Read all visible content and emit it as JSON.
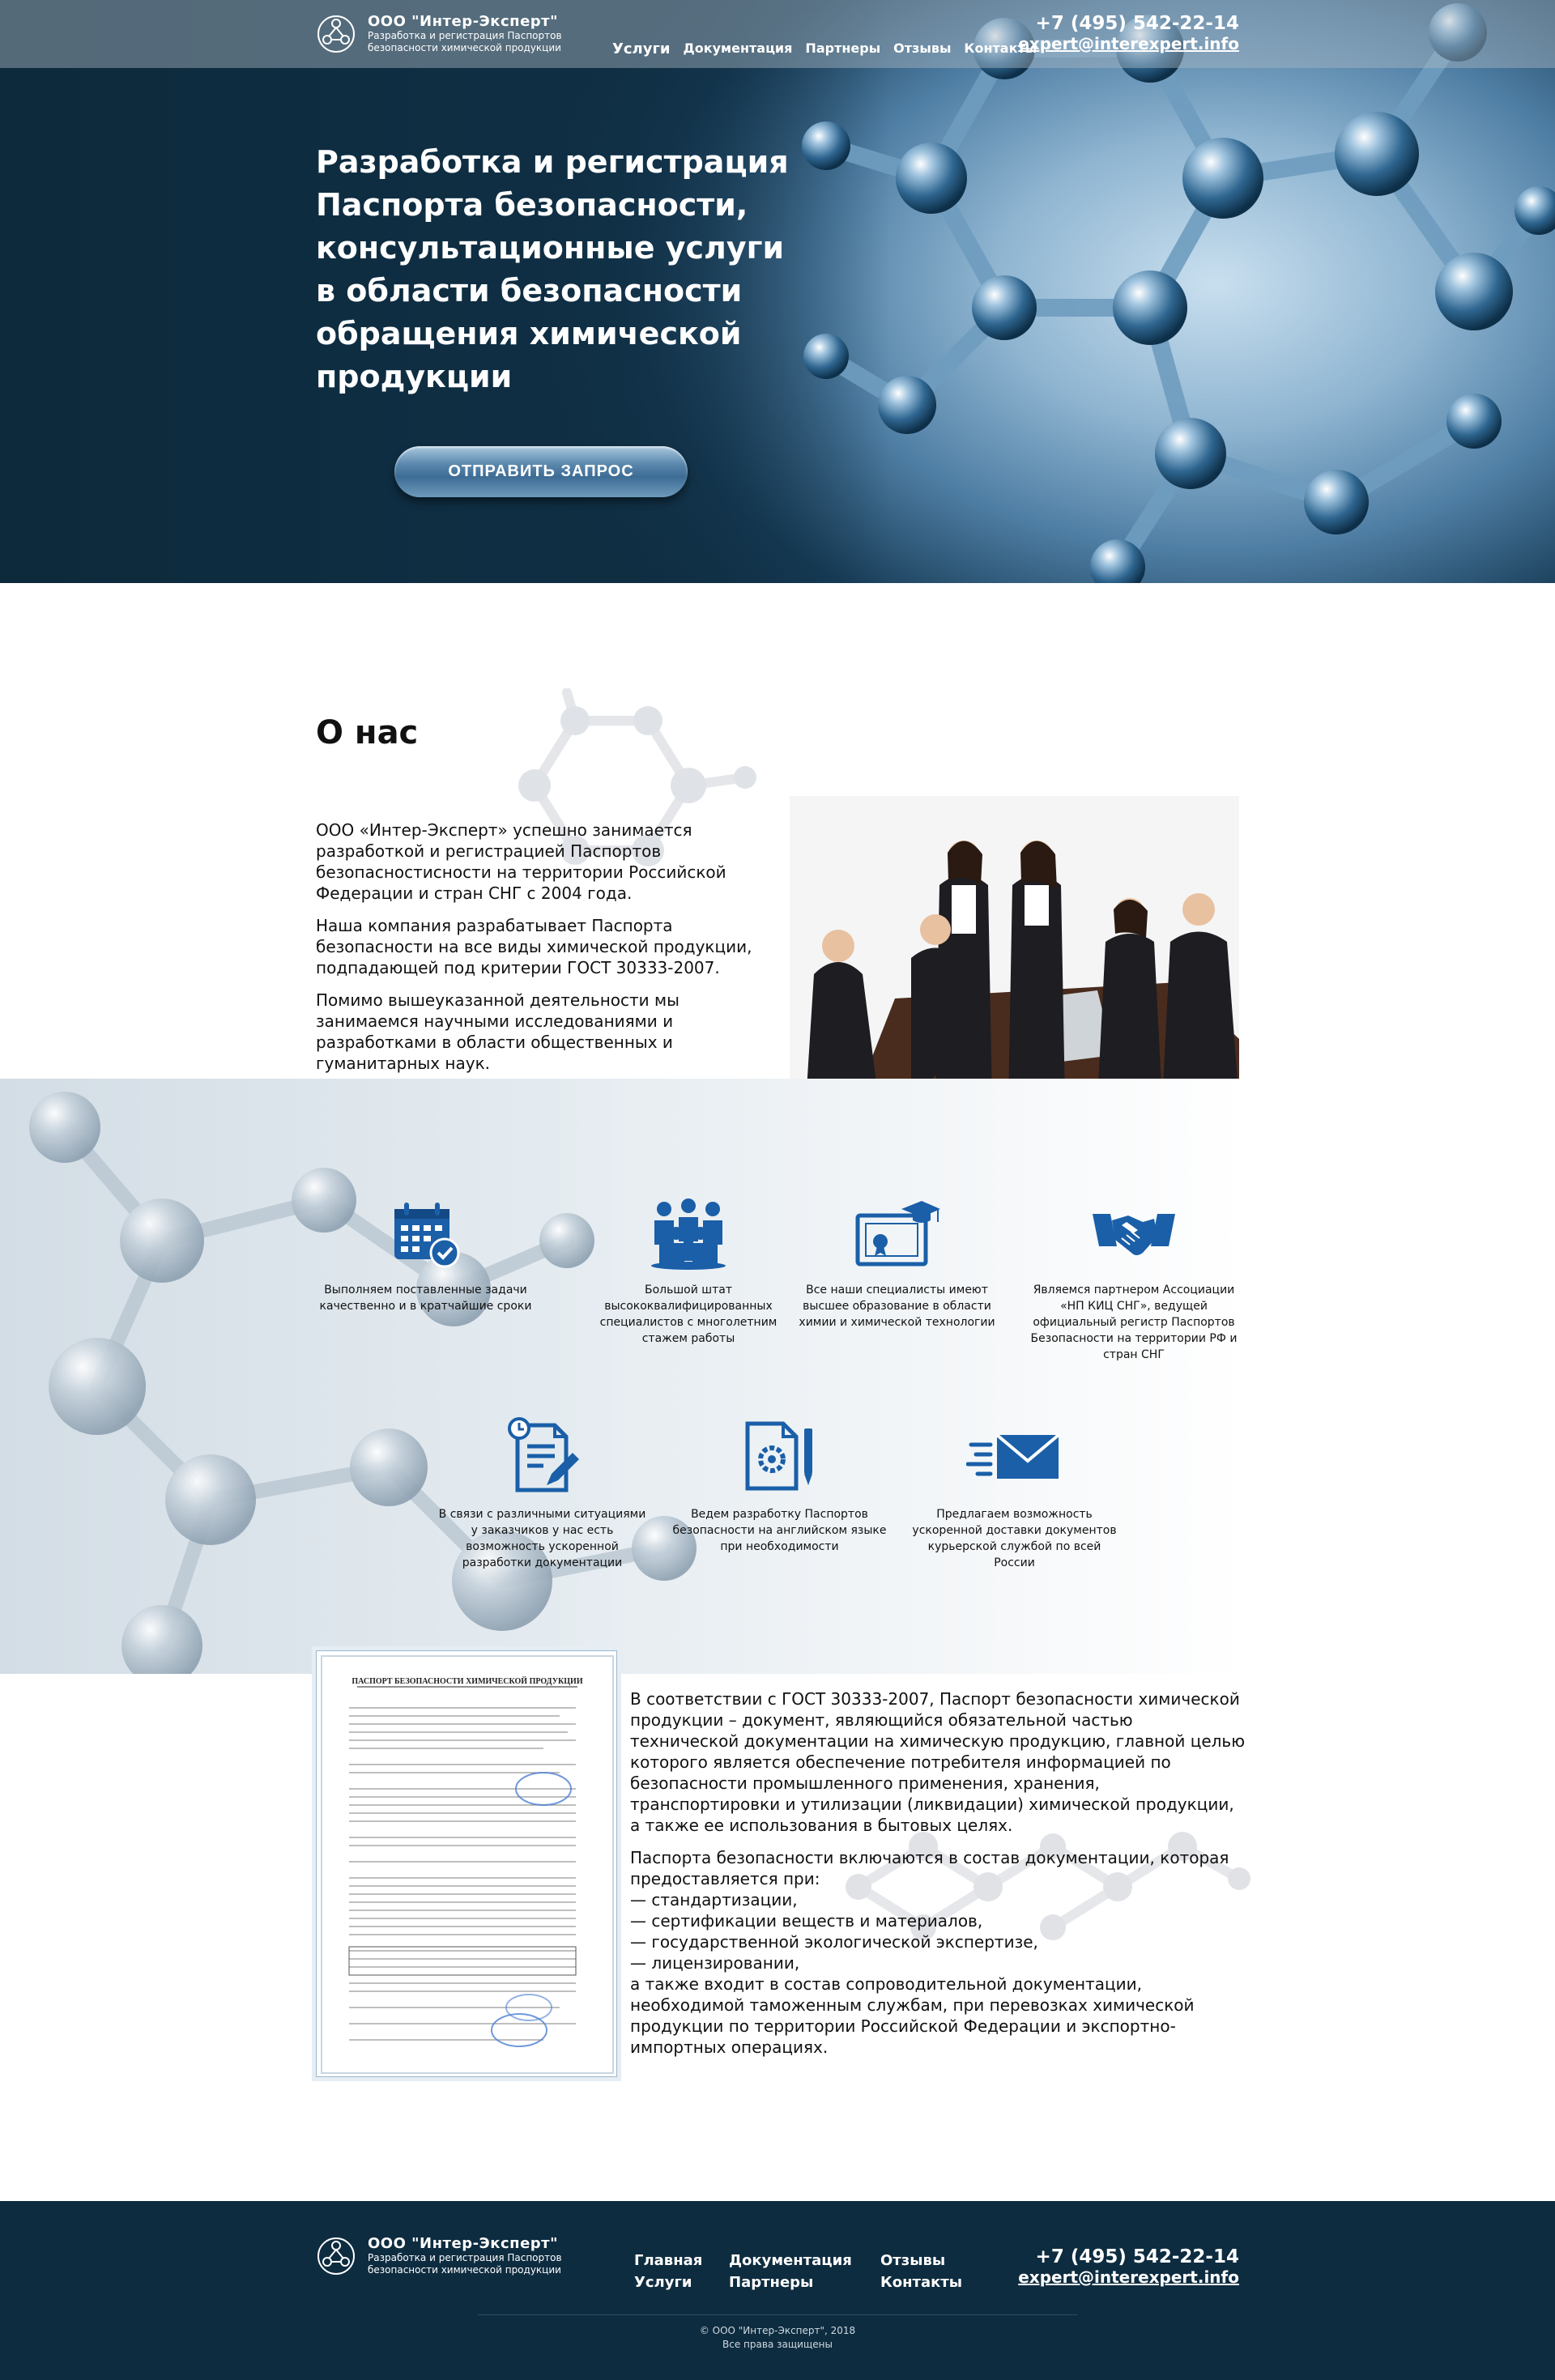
{
  "header": {
    "company_name": "ООО \"Интер-Эксперт\"",
    "tagline_line1": "Разработка и регистрация Паспортов",
    "tagline_line2": "безопасности химической продукции",
    "nav": [
      "Услуги",
      "Документация",
      "Партнеры",
      "Отзывы",
      "Контакты"
    ],
    "phone": "+7 (495) 542-22-14",
    "email": "expert@interexpert.info"
  },
  "hero": {
    "title_lines": [
      "Разработка и регистрация",
      "Паспорта безопасности,",
      "консультационные услуги",
      "в области безопасности",
      "обращения химической",
      "продукции"
    ],
    "cta_label": "ОТПРАВИТЬ ЗАПРОС"
  },
  "about": {
    "title": "О нас",
    "paragraphs": [
      "ООО «Интер-Эксперт» успешно занимается разработкой и регистрацией Паспортов безопасностисности на территории Российской Федерации и стран СНГ с 2004 года.",
      "Наша компания разрабатывает Паспорта безопасности на все виды химической продукции, подпадающей под критерии ГОСТ 30333-2007.",
      "Помимо вышеуказанной деятельности мы занимаемся научными исследованиями и разработками в области общественных и гуманитарных наук."
    ]
  },
  "features": [
    {
      "icon": "calendar-check-icon",
      "text": "Выполняем поставленные задачи качественно и в кратчайшие сроки"
    },
    {
      "icon": "team-icon",
      "text": "Большой штат высококвалифицированных специалистов с многолетним стажем работы"
    },
    {
      "icon": "diploma-icon",
      "text": "Все наши специалисты имеют высшее образование в области химии и химической технологии"
    },
    {
      "icon": "handshake-icon",
      "text": "Являемся партнером Ассоциации «НП КИЦ СНГ», ведущей официальный регистр Паспортов Безопасности на территории РФ и стран СНГ"
    },
    {
      "icon": "document-edit-icon",
      "text": "В связи с различными ситуациями у заказчиков у нас есть возможность ускоренной разработки документации"
    },
    {
      "icon": "document-gear-icon",
      "text": "Ведем разработку Паспортов безопасности на английском языке при необходимости"
    },
    {
      "icon": "fast-mail-icon",
      "text": "Предлагаем возможность ускоренной доставки документов курьерской службой по всей России"
    }
  ],
  "passport": {
    "doc_title": "ПАСПОРТ БЕЗОПАСНОСТИ ХИМИЧЕСКОЙ ПРОДУКЦИИ",
    "intro": "В соответствии с ГОСТ 30333-2007, Паспорт безопасности химической продукции – документ, являющийся обязательной частью технической документации на химическую продукцию, главной целью которого является обеспечение потребителя информацией по безопасности промышленного применения, хранения, транспортировки и утилизации (ликвидации) химической продукции, а также ее использования в бытовых целях.",
    "lead": "Паспорта безопасности включаются в состав документации, которая предоставляется при:",
    "list": [
      "— стандартизации,",
      "— сертификации веществ и материалов,",
      "— государственной экологической экспертизе,",
      "— лицензировании,"
    ],
    "outro": "а также входит в состав сопроводительной документации, необходимой таможенным службам, при перевозках химической продукции по территории Российской Федерации и экспортно-импортных операциях."
  },
  "footer": {
    "col1": [
      "Главная",
      "Услуги"
    ],
    "col2": [
      "Документация",
      "Партнеры"
    ],
    "col3": [
      "Отзывы",
      "Контакты"
    ],
    "copyright": "© ООО \"Интер-Эксперт\", 2018",
    "rights": "Все права защищены"
  },
  "colors": {
    "brand_dark": "#0e2c40",
    "icon_blue": "#1a5fa8"
  }
}
